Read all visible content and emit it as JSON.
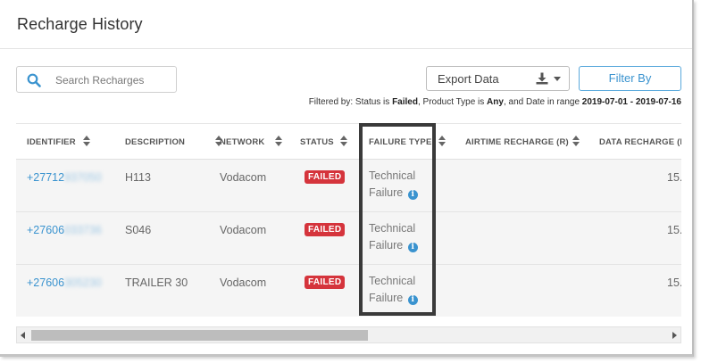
{
  "header": {
    "title": "Recharge History"
  },
  "search": {
    "placeholder": "Search Recharges",
    "icon": "search-icon"
  },
  "toolbar": {
    "export_label": "Export Data",
    "filter_label": "Filter By"
  },
  "filter_summary": {
    "prefix": "Filtered by: Status is ",
    "status": "Failed",
    "mid1": ", Product Type is ",
    "product_type": "Any",
    "mid2": ", and Date in range ",
    "date_range": "2019-07-01 - 2019-07-16"
  },
  "table": {
    "columns": [
      "IDENTIFIER",
      "DESCRIPTION",
      "NETWORK",
      "STATUS",
      "FAILURE TYPE",
      "AIRTIME RECHARGE (R)",
      "DATA RECHARGE (M"
    ],
    "rows": [
      {
        "id_prefix": "+27712",
        "id_rest": "937050",
        "description": "H113",
        "network": "Vodacom",
        "status": "FAILED",
        "failure_line1": "Technical",
        "failure_line2": "Failure",
        "data": "15."
      },
      {
        "id_prefix": "+27606",
        "id_rest": "033736",
        "description": "S046",
        "network": "Vodacom",
        "status": "FAILED",
        "failure_line1": "Technical",
        "failure_line2": "Failure",
        "data": "15."
      },
      {
        "id_prefix": "+27606",
        "id_rest": "305230",
        "description": "TRAILER 30",
        "network": "Vodacom",
        "status": "FAILED",
        "failure_line1": "Technical",
        "failure_line2": "Failure",
        "data": "15."
      }
    ]
  },
  "colors": {
    "accent": "#3a93cf",
    "failed_badge": "#d5343c",
    "highlight_border": "#3a3a3a"
  }
}
